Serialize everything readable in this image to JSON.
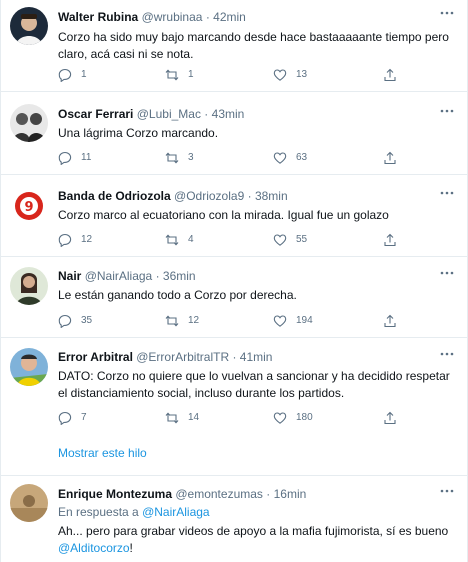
{
  "tweets": [
    {
      "name": "Walter Rubina",
      "handle": "@wrubinaa",
      "dot": "·",
      "time": "42min",
      "text": "Corzo ha sido muy bajo marcando desde hace bastaaaaante tiempo pero claro, acá casi ni se nota.",
      "replies": "1",
      "retweets": "1",
      "likes": "13"
    },
    {
      "name": "Oscar Ferrari",
      "handle": "@Lubi_Mac",
      "dot": "·",
      "time": "43min",
      "text": "Una lágrima Corzo marcando.",
      "replies": "11",
      "retweets": "3",
      "likes": "63"
    },
    {
      "name": "Banda de Odriozola",
      "handle": "@Odriozola9",
      "dot": "·",
      "time": "38min",
      "text": "Corzo marco al ecuatoriano con la mirada. Igual fue un golazo",
      "replies": "12",
      "retweets": "4",
      "likes": "55"
    },
    {
      "name": "Nair",
      "handle": "@NairAliaga",
      "dot": "·",
      "time": "36min",
      "text": "Le están ganando todo a Corzo por derecha.",
      "replies": "35",
      "retweets": "12",
      "likes": "194"
    },
    {
      "name": "Error Arbitral",
      "handle": "@ErrorArbitralTR",
      "dot": "·",
      "time": "41min",
      "text": "DATO: Corzo no quiere que lo vuelvan a sancionar y ha decidido respetar el distanciamiento social, incluso durante los partidos.",
      "replies": "7",
      "retweets": "14",
      "likes": "180"
    },
    {
      "name": "Enrique Montezuma",
      "handle": "@emontezumas",
      "dot": "·",
      "time": "16min",
      "reply_prefix": "En respuesta a",
      "reply_to": "@NairAliaga",
      "text": "Ah... pero para grabar videos de apoyo a la mafia fujimorista, sí es bueno",
      "mention": "@Alditocorzo",
      "text_suffix": "!"
    }
  ],
  "show_thread": "Mostrar este hilo",
  "colors": {
    "link": "#1b95e0",
    "muted": "#5b7083",
    "border": "#e6ecf0",
    "text": "#0f1419"
  },
  "icons": [
    "reply-icon",
    "retweet-icon",
    "like-icon",
    "share-icon",
    "more-icon"
  ]
}
